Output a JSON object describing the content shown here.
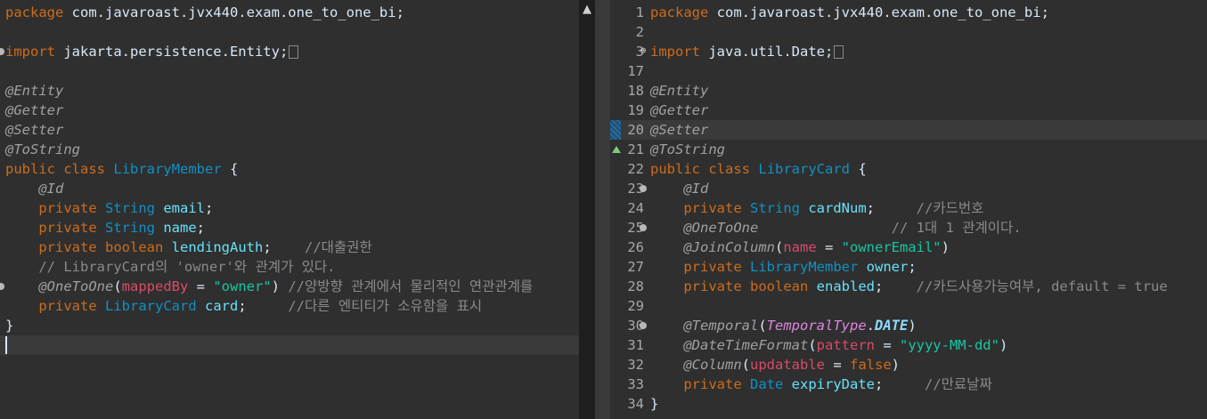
{
  "left_editor": {
    "lines": [
      [
        {
          "t": "package",
          "c": "kw"
        },
        {
          "t": " com.javaroast.jvx440.exam.one_to_one_bi;",
          "c": "pl"
        }
      ],
      [],
      [
        {
          "t": "import",
          "c": "kw"
        },
        {
          "t": " jakarta.persistence.Entity;",
          "c": "pl"
        }
      ],
      [],
      [
        {
          "t": "@Entity",
          "c": "an"
        }
      ],
      [
        {
          "t": "@Getter",
          "c": "an"
        }
      ],
      [
        {
          "t": "@Setter",
          "c": "an"
        }
      ],
      [
        {
          "t": "@ToString",
          "c": "an"
        }
      ],
      [
        {
          "t": "public",
          "c": "kw"
        },
        {
          "t": " ",
          "c": "pl"
        },
        {
          "t": "class",
          "c": "kw"
        },
        {
          "t": " ",
          "c": "pl"
        },
        {
          "t": "LibraryMember",
          "c": "ty"
        },
        {
          "t": " {",
          "c": "pl"
        }
      ],
      [
        {
          "t": "    ",
          "c": "pl"
        },
        {
          "t": "@Id",
          "c": "an"
        }
      ],
      [
        {
          "t": "    ",
          "c": "pl"
        },
        {
          "t": "private",
          "c": "kw"
        },
        {
          "t": " ",
          "c": "pl"
        },
        {
          "t": "String",
          "c": "ty"
        },
        {
          "t": " ",
          "c": "pl"
        },
        {
          "t": "email",
          "c": "fd"
        },
        {
          "t": ";",
          "c": "pl"
        }
      ],
      [
        {
          "t": "    ",
          "c": "pl"
        },
        {
          "t": "private",
          "c": "kw"
        },
        {
          "t": " ",
          "c": "pl"
        },
        {
          "t": "String",
          "c": "ty"
        },
        {
          "t": " ",
          "c": "pl"
        },
        {
          "t": "name",
          "c": "fd"
        },
        {
          "t": ";",
          "c": "pl"
        }
      ],
      [
        {
          "t": "    ",
          "c": "pl"
        },
        {
          "t": "private",
          "c": "kw"
        },
        {
          "t": " ",
          "c": "pl"
        },
        {
          "t": "boolean",
          "c": "kw"
        },
        {
          "t": " ",
          "c": "pl"
        },
        {
          "t": "lendingAuth",
          "c": "fd"
        },
        {
          "t": ";    ",
          "c": "pl"
        },
        {
          "t": "//대출권한",
          "c": "cm"
        }
      ],
      [
        {
          "t": "    ",
          "c": "pl"
        },
        {
          "t": "// LibraryCard의 'owner'와 관계가 있다.",
          "c": "cm"
        }
      ],
      [
        {
          "t": "    ",
          "c": "pl"
        },
        {
          "t": "@OneToOne",
          "c": "an"
        },
        {
          "t": "(",
          "c": "pl"
        },
        {
          "t": "mappedBy",
          "c": "ak"
        },
        {
          "t": " = ",
          "c": "pl"
        },
        {
          "t": "\"owner\"",
          "c": "st"
        },
        {
          "t": ") ",
          "c": "pl"
        },
        {
          "t": "//양방향 관계에서 물리적인 연관관계를",
          "c": "cm"
        }
      ],
      [
        {
          "t": "    ",
          "c": "pl"
        },
        {
          "t": "private",
          "c": "kw"
        },
        {
          "t": " ",
          "c": "pl"
        },
        {
          "t": "LibraryCard",
          "c": "ty"
        },
        {
          "t": " ",
          "c": "pl"
        },
        {
          "t": "card",
          "c": "fd"
        },
        {
          "t": ";     ",
          "c": "pl"
        },
        {
          "t": "//다른 엔티티가 소유함을 표시",
          "c": "cm"
        }
      ],
      [
        {
          "t": "}",
          "c": "pl"
        }
      ],
      []
    ]
  },
  "right_editor": {
    "line_numbers": [
      "1",
      "2",
      "3",
      "17",
      "18",
      "19",
      "20",
      "21",
      "22",
      "23",
      "24",
      "25",
      "26",
      "27",
      "28",
      "29",
      "30",
      "31",
      "32",
      "33",
      "34"
    ],
    "lines": [
      [
        {
          "t": "package",
          "c": "kw"
        },
        {
          "t": " com.javaroast.jvx440.exam.one_to_one_bi;",
          "c": "pl"
        }
      ],
      [],
      [
        {
          "t": "import",
          "c": "kw"
        },
        {
          "t": " java.util.Date;",
          "c": "pl"
        }
      ],
      [],
      [
        {
          "t": "@Entity",
          "c": "an"
        }
      ],
      [
        {
          "t": "@Getter",
          "c": "an"
        }
      ],
      [
        {
          "t": "@Setter",
          "c": "an"
        }
      ],
      [
        {
          "t": "@ToString",
          "c": "an"
        }
      ],
      [
        {
          "t": "public",
          "c": "kw"
        },
        {
          "t": " ",
          "c": "pl"
        },
        {
          "t": "class",
          "c": "kw"
        },
        {
          "t": " ",
          "c": "pl"
        },
        {
          "t": "LibraryCard",
          "c": "ty"
        },
        {
          "t": " {",
          "c": "pl"
        }
      ],
      [
        {
          "t": "    ",
          "c": "pl"
        },
        {
          "t": "@Id",
          "c": "an"
        }
      ],
      [
        {
          "t": "    ",
          "c": "pl"
        },
        {
          "t": "private",
          "c": "kw"
        },
        {
          "t": " ",
          "c": "pl"
        },
        {
          "t": "String",
          "c": "ty"
        },
        {
          "t": " ",
          "c": "pl"
        },
        {
          "t": "cardNum",
          "c": "fd"
        },
        {
          "t": ";     ",
          "c": "pl"
        },
        {
          "t": "//카드번호",
          "c": "cm"
        }
      ],
      [
        {
          "t": "    ",
          "c": "pl"
        },
        {
          "t": "@OneToOne",
          "c": "an"
        },
        {
          "t": "                ",
          "c": "pl"
        },
        {
          "t": "// 1대 1 관계이다.",
          "c": "cm"
        }
      ],
      [
        {
          "t": "    ",
          "c": "pl"
        },
        {
          "t": "@JoinColumn",
          "c": "an"
        },
        {
          "t": "(",
          "c": "pl"
        },
        {
          "t": "name",
          "c": "ak"
        },
        {
          "t": " = ",
          "c": "pl"
        },
        {
          "t": "\"ownerEmail\"",
          "c": "st"
        },
        {
          "t": ")",
          "c": "pl"
        }
      ],
      [
        {
          "t": "    ",
          "c": "pl"
        },
        {
          "t": "private",
          "c": "kw"
        },
        {
          "t": " ",
          "c": "pl"
        },
        {
          "t": "LibraryMember",
          "c": "ty"
        },
        {
          "t": " ",
          "c": "pl"
        },
        {
          "t": "owner",
          "c": "fd"
        },
        {
          "t": ";",
          "c": "pl"
        }
      ],
      [
        {
          "t": "    ",
          "c": "pl"
        },
        {
          "t": "private",
          "c": "kw"
        },
        {
          "t": " ",
          "c": "pl"
        },
        {
          "t": "boolean",
          "c": "kw"
        },
        {
          "t": " ",
          "c": "pl"
        },
        {
          "t": "enabled",
          "c": "fd"
        },
        {
          "t": ";    ",
          "c": "pl"
        },
        {
          "t": "//카드사용가능여부, default = true",
          "c": "cm"
        }
      ],
      [],
      [
        {
          "t": "    ",
          "c": "pl"
        },
        {
          "t": "@Temporal",
          "c": "an"
        },
        {
          "t": "(",
          "c": "pl"
        },
        {
          "t": "TemporalType",
          "c": "en"
        },
        {
          "t": ".",
          "c": "pl"
        },
        {
          "t": "DATE",
          "c": "ec"
        },
        {
          "t": ")",
          "c": "pl"
        }
      ],
      [
        {
          "t": "    ",
          "c": "pl"
        },
        {
          "t": "@DateTimeFormat",
          "c": "an"
        },
        {
          "t": "(",
          "c": "pl"
        },
        {
          "t": "pattern",
          "c": "ak"
        },
        {
          "t": " = ",
          "c": "pl"
        },
        {
          "t": "\"yyyy-MM-dd\"",
          "c": "st"
        },
        {
          "t": ")",
          "c": "pl"
        }
      ],
      [
        {
          "t": "    ",
          "c": "pl"
        },
        {
          "t": "@Column",
          "c": "an"
        },
        {
          "t": "(",
          "c": "pl"
        },
        {
          "t": "updatable",
          "c": "ak"
        },
        {
          "t": " = ",
          "c": "pl"
        },
        {
          "t": "false",
          "c": "kw"
        },
        {
          "t": ")",
          "c": "pl"
        }
      ],
      [
        {
          "t": "    ",
          "c": "pl"
        },
        {
          "t": "private",
          "c": "kw"
        },
        {
          "t": " ",
          "c": "pl"
        },
        {
          "t": "Date",
          "c": "ty"
        },
        {
          "t": " ",
          "c": "pl"
        },
        {
          "t": "expiryDate",
          "c": "fd"
        },
        {
          "t": ";     ",
          "c": "pl"
        },
        {
          "t": "//만료날짜",
          "c": "cm"
        }
      ],
      [
        {
          "t": "}",
          "c": "pl"
        }
      ]
    ]
  },
  "colors": {
    "background": "#2f2f2f",
    "keyword": "#cc6c1d",
    "type": "#1290c3",
    "field": "#66e1f8",
    "annotation": "#a0a0a0",
    "string": "#17c6a3",
    "comment": "#8a8a8a",
    "annotation_key": "#d94a6a"
  },
  "icons": {
    "scroll_up": "▲"
  }
}
